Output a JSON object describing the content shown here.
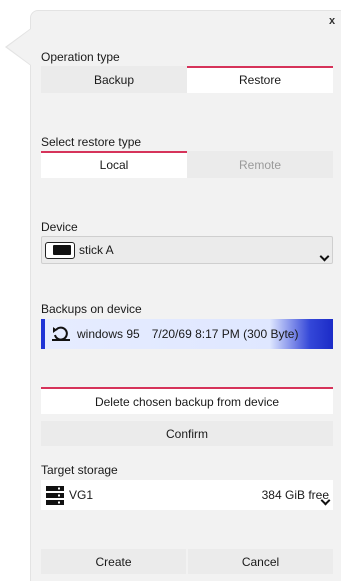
{
  "popover": {
    "close_label": "x"
  },
  "operation": {
    "label": "Operation type",
    "options": [
      "Backup",
      "Restore"
    ],
    "active": "Restore"
  },
  "restore_type": {
    "label": "Select restore type",
    "options": [
      "Local",
      "Remote"
    ],
    "active": "Local"
  },
  "device": {
    "label": "Device",
    "selected": "stick A",
    "icon": "usb-drive-icon"
  },
  "backups": {
    "label": "Backups on device",
    "item": {
      "name": "windows 95",
      "date": "7/20/69 8:17 PM (300 Byte)",
      "icon": "restore-icon"
    }
  },
  "actions": {
    "delete_label": "Delete chosen backup from device",
    "confirm_label": "Confirm"
  },
  "target": {
    "label": "Target storage",
    "name": "VG1",
    "free": "384 GiB free",
    "icon": "server-icon"
  },
  "footer": {
    "create_label": "Create",
    "cancel_label": "Cancel"
  },
  "colors": {
    "accent": "#d6335a",
    "selection": "#1f34d6",
    "panel": "#f2f2f2"
  }
}
